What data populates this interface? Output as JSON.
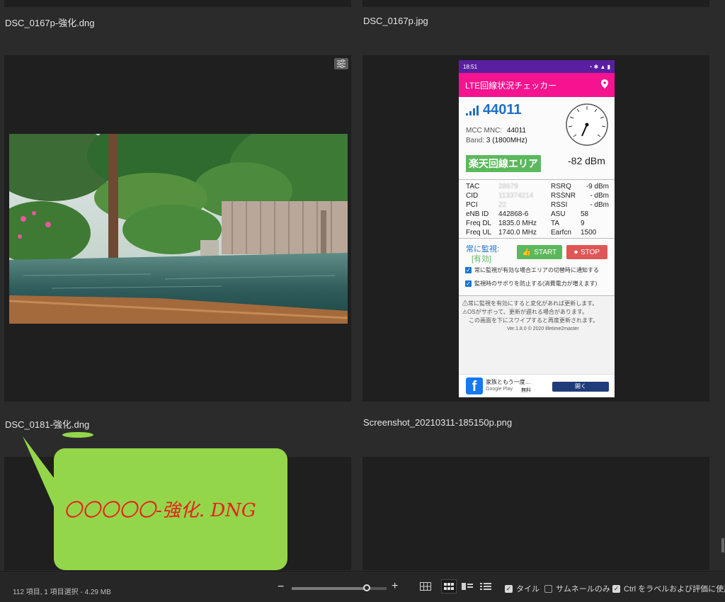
{
  "files": [
    {
      "name": "DSC_0167p-強化.dng"
    },
    {
      "name": "DSC_0167p.jpg"
    },
    {
      "name": "DSC_0181-強化.dng"
    },
    {
      "name": "Screenshot_20210311-185150p.png"
    }
  ],
  "phone": {
    "time": "18:51",
    "app_title": "LTE回線状況チェッカー",
    "plmn": "44011",
    "mcc_mnc_label": "MCC MNC:",
    "mcc_mnc_value": "44011",
    "band_label": "Band:",
    "band_value": "3 (1800MHz)",
    "area_badge": "楽天回線エリア",
    "dbm": "-82 dBm",
    "rows": [
      {
        "l1": "TAC",
        "v1": "28679",
        "l2": "RSRQ",
        "v2": "-9 dBm"
      },
      {
        "l1": "CID",
        "v1": "113374214",
        "l2": "RSSNR",
        "v2": "- dBm"
      },
      {
        "l1": "PCI",
        "v1": "22",
        "l2": "RSSI",
        "v2": "- dBm"
      },
      {
        "l1": "eNB ID",
        "v1": "442868-6",
        "l2": "ASU",
        "v2": "58"
      },
      {
        "l1": "Freq DL",
        "v1": "1835.0 MHz",
        "l2": "TA",
        "v2": "9"
      },
      {
        "l1": "Freq UL",
        "v1": "1740.0 MHz",
        "l2": "Earfcn",
        "v2": "1500"
      }
    ],
    "monitor_label": "常に監視:",
    "monitor_state": "[有効]",
    "start_label": "START",
    "stop_label": "STOP",
    "check1": "常に監視が有効な場合エリアの切替時に通知する",
    "check2": "監視時のサボりを防止する(消費電力が増えます)",
    "note1": "常に監視を有効にすると変化があれば更新します。",
    "note2": "OSがサボって、更新が遅れる場合があります。",
    "note3": "この画面を下にスワイプすると再度更新されます。",
    "version": "Ver.1.8.0 © 2020 lifetime2master",
    "ad_title": "家族ともう一度…",
    "ad_store": "Google Play",
    "ad_price": "無料",
    "ad_button": "開く"
  },
  "callout": {
    "text": "〇〇〇〇〇-強化. DNG"
  },
  "statusbar": {
    "summary": "112 項目, 1 項目選択 - 4.29 MB",
    "tile_label": "タイル",
    "thumb_only_label": "サムネールのみ",
    "ctrl_label": "Ctrl をラベルおよび評価に使用",
    "tile_checked": true,
    "thumb_only_checked": false,
    "ctrl_checked": true,
    "zoom_level": 0.78
  },
  "colors": {
    "background": "#2b2b2b",
    "cell": "#1f1f1f",
    "callout": "#94d64a",
    "app_bar": "#f5138f",
    "area_badge": "#5cb85c"
  }
}
